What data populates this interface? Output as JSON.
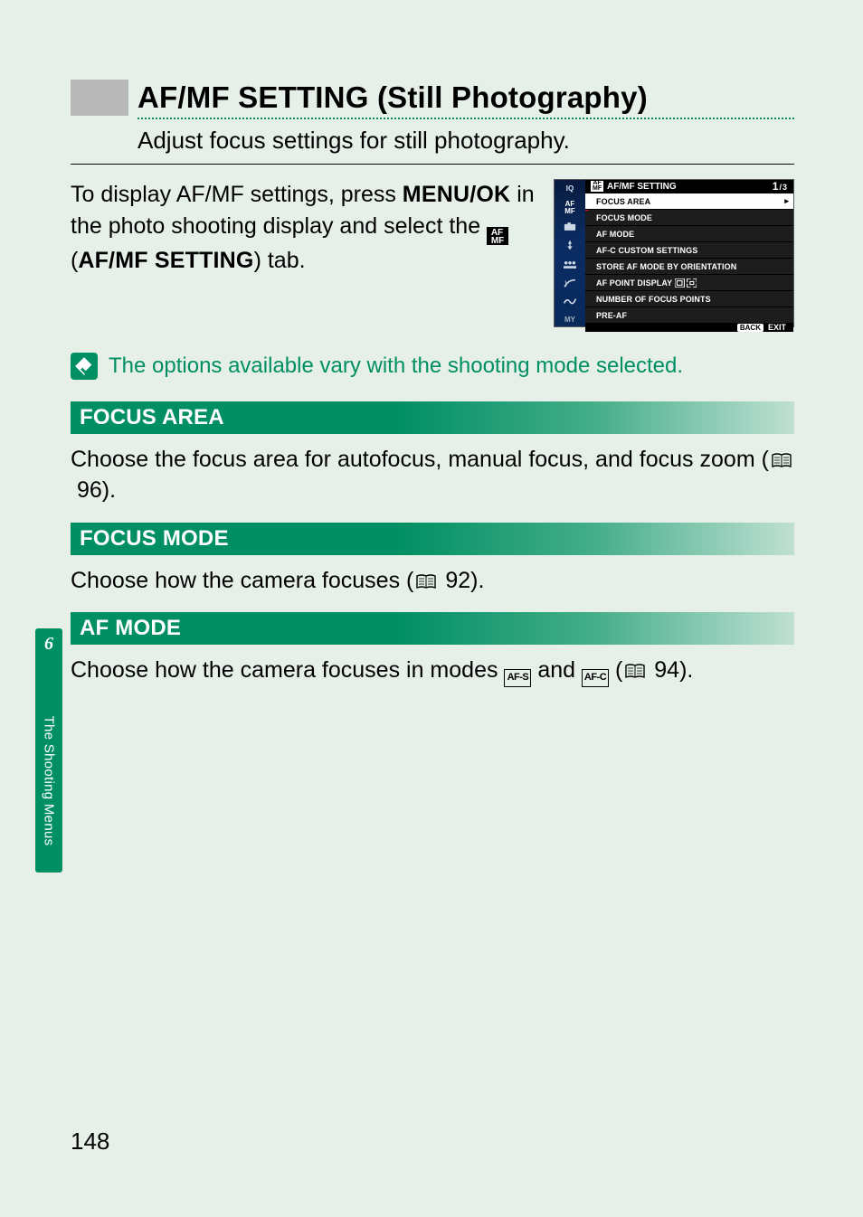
{
  "header": {
    "title": "AF/MF SETTING (Still Photography)",
    "subtitle": "Adjust focus settings for still photography."
  },
  "intro": {
    "line_pre": "To display AF/MF settings, press ",
    "menu_ok": "MENU/OK",
    "line_mid": " in the photo shooting display and select the ",
    "tab_icon_label": "AF\nMF",
    "line_post": " (",
    "setting_name": "AF/MF SETTING",
    "line_end": ") tab."
  },
  "camera_menu": {
    "header_icon": "AF\nMF",
    "header_title": "AF/MF SETTING",
    "page_current": "1",
    "page_sep": "/",
    "page_total": "3",
    "left_tabs": [
      "IQ",
      "AF\nMF",
      "",
      "",
      "",
      "",
      "",
      "MY"
    ],
    "items": [
      "FOCUS AREA",
      "FOCUS MODE",
      "AF MODE",
      "AF-C CUSTOM SETTINGS",
      "STORE AF MODE BY ORIENTATION",
      "AF POINT DISPLAY",
      "NUMBER OF FOCUS POINTS",
      "PRE-AF"
    ],
    "selected_index": 0,
    "footer_button": "BACK",
    "footer_label": "EXIT"
  },
  "note": "The options available vary with the shooting mode selected.",
  "sections": [
    {
      "heading": "FOCUS AREA",
      "body_pre": "Choose the focus area for autofocus, manual focus, and focus zoom (",
      "page_ref": "96",
      "body_post": ").",
      "modes": []
    },
    {
      "heading": "FOCUS MODE",
      "body_pre": "Choose how the camera focuses (",
      "page_ref": "92",
      "body_post": ").",
      "modes": []
    },
    {
      "heading": "AF MODE",
      "body_pre": "Choose how the camera focuses in modes ",
      "modes": [
        "AF-S",
        "AF-C"
      ],
      "modes_sep": " and ",
      "page_ref": "94",
      "body_post": ").",
      "after_modes": " ("
    }
  ],
  "side_tab": {
    "number": "6",
    "label": "The Shooting Menus"
  },
  "page_number": "148"
}
